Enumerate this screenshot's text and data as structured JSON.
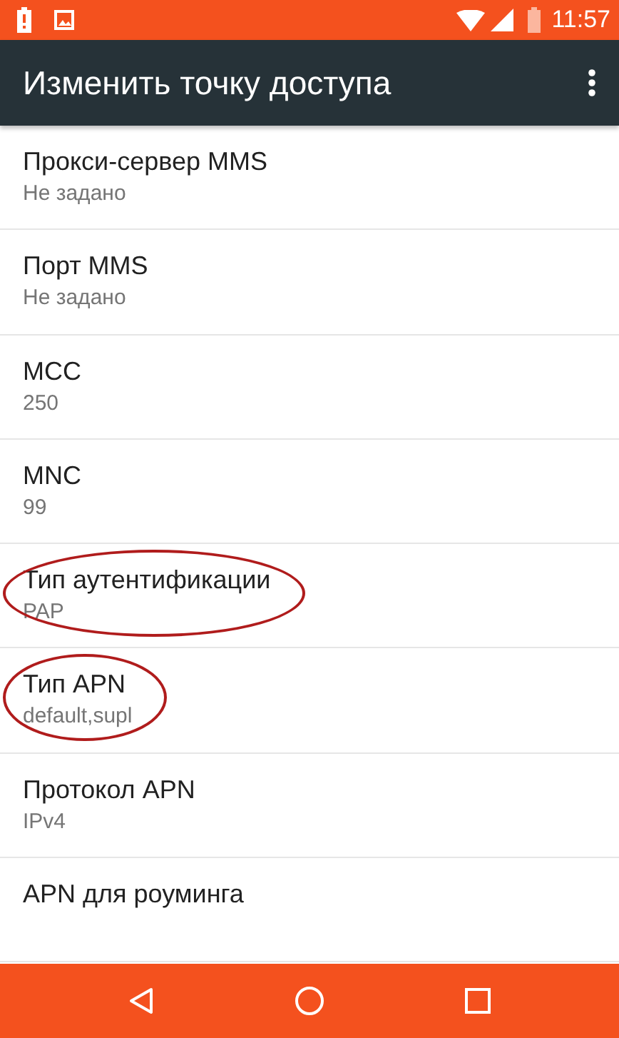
{
  "status_bar": {
    "time": "11:57"
  },
  "app_bar": {
    "title": "Изменить точку доступа"
  },
  "settings": [
    {
      "title": "Прокси-сервер MMS",
      "value": "Не задано",
      "circled": false
    },
    {
      "title": "Порт MMS",
      "value": "Не задано",
      "circled": false
    },
    {
      "title": "MCC",
      "value": "250",
      "circled": false
    },
    {
      "title": "MNC",
      "value": "99",
      "circled": false
    },
    {
      "title": "Тип аутентификации",
      "value": "PAP",
      "circled": true
    },
    {
      "title": "Тип APN",
      "value": "default,supl",
      "circled": true
    },
    {
      "title": "Протокол APN",
      "value": "IPv4",
      "circled": false
    },
    {
      "title": "APN для роуминга",
      "circled": false
    }
  ]
}
